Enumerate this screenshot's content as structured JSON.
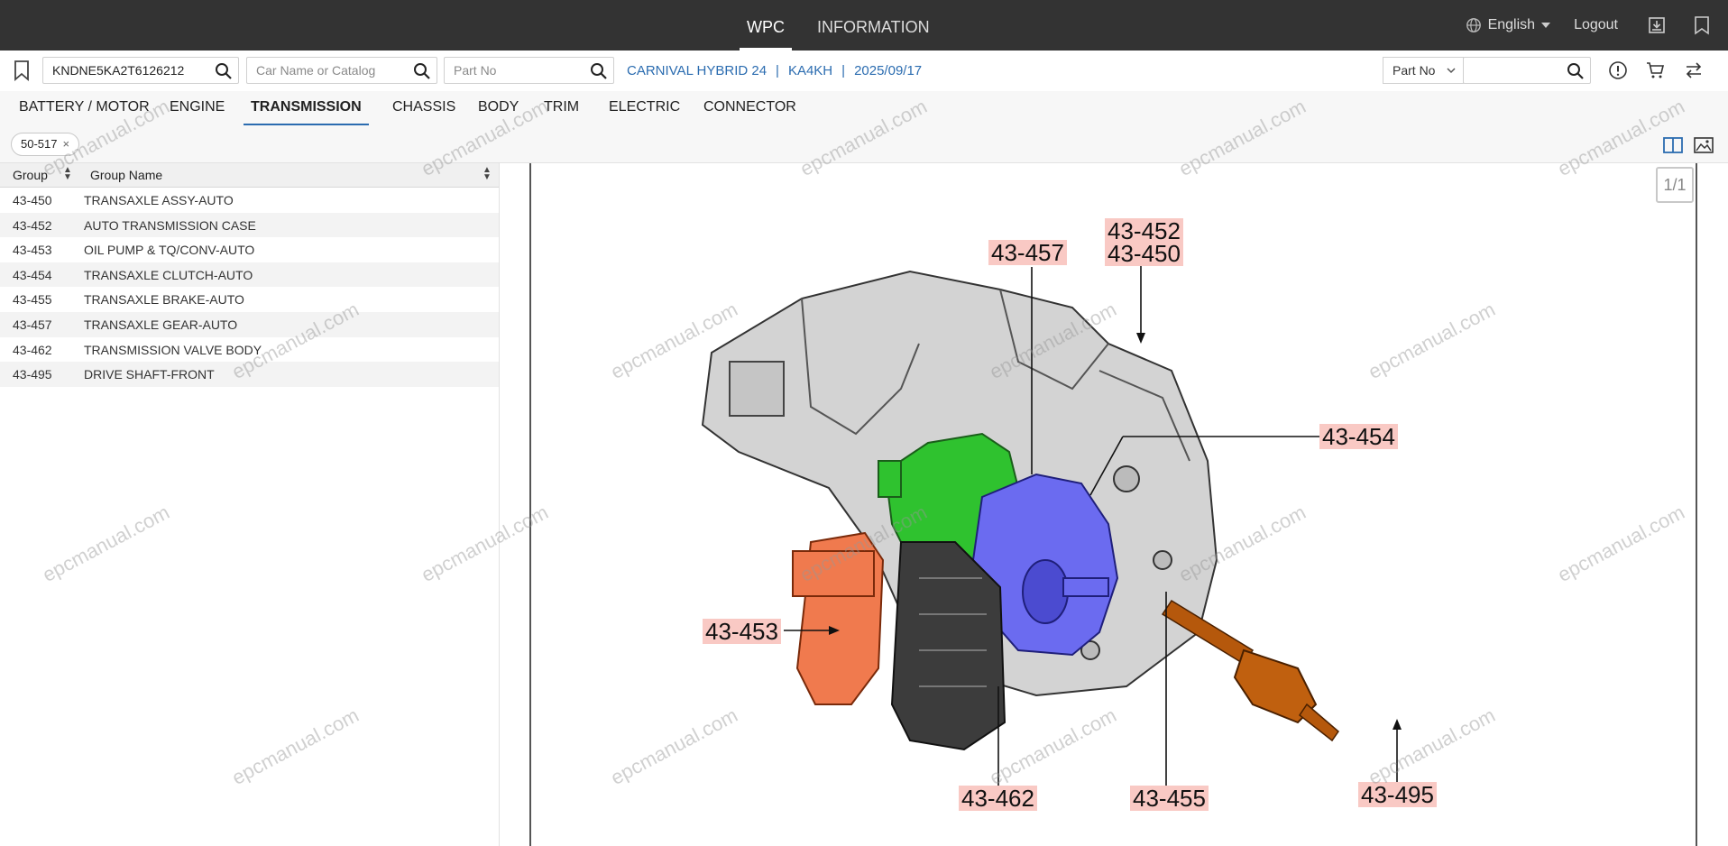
{
  "topbar": {
    "nav": [
      "WPC",
      "INFORMATION"
    ],
    "language": "English",
    "logout": "Logout"
  },
  "search": {
    "vin_value": "KNDNE5KA2T6126212",
    "car_placeholder": "Car Name or Catalog",
    "partno_placeholder": "Part No",
    "crumbs": [
      "CARNIVAL HYBRID 24",
      "KA4KH",
      "2025/09/17"
    ],
    "pn_select": "Part No",
    "pn_value": ""
  },
  "categories": [
    "BATTERY / MOTOR",
    "ENGINE",
    "TRANSMISSION",
    "CHASSIS",
    "BODY",
    "TRIM",
    "ELECTRIC",
    "CONNECTOR"
  ],
  "filter_chip": "50-517",
  "table": {
    "headers": [
      "Group",
      "Group Name"
    ],
    "rows": [
      {
        "code": "43-450",
        "name": "TRANSAXLE ASSY-AUTO"
      },
      {
        "code": "43-452",
        "name": "AUTO TRANSMISSION CASE"
      },
      {
        "code": "43-453",
        "name": "OIL PUMP & TQ/CONV-AUTO"
      },
      {
        "code": "43-454",
        "name": "TRANSAXLE CLUTCH-AUTO"
      },
      {
        "code": "43-455",
        "name": "TRANSAXLE BRAKE-AUTO"
      },
      {
        "code": "43-457",
        "name": "TRANSAXLE GEAR-AUTO"
      },
      {
        "code": "43-462",
        "name": "TRANSMISSION VALVE BODY"
      },
      {
        "code": "43-495",
        "name": "DRIVE SHAFT-FRONT"
      }
    ]
  },
  "diagram": {
    "pager": "1/1",
    "callouts": [
      "43-457",
      "43-452",
      "43-450",
      "43-454",
      "43-453",
      "43-462",
      "43-455",
      "43-495"
    ]
  },
  "watermark": "epcmanual.com"
}
